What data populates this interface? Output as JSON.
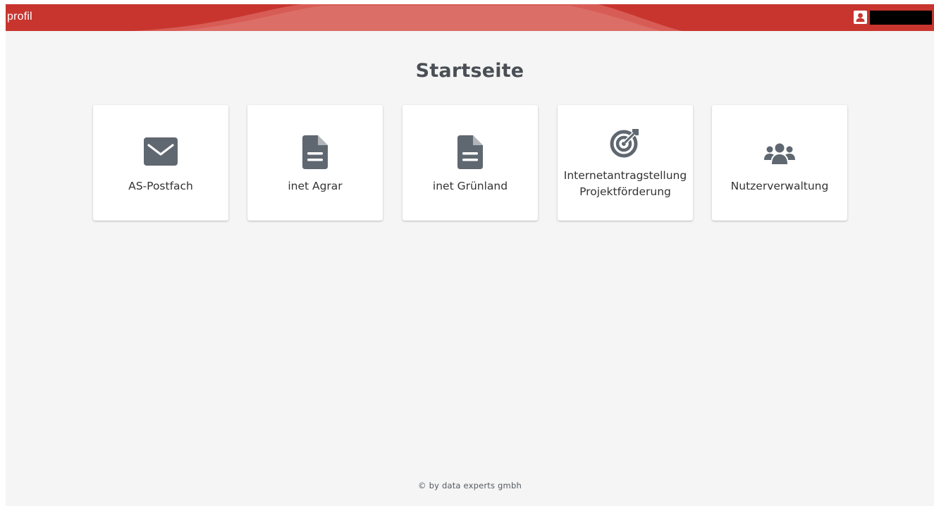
{
  "header": {
    "app_title": "profil",
    "user_icon": "user-account-icon",
    "user_name": "",
    "brand_color": "#c8352f"
  },
  "main": {
    "page_title": "Startseite",
    "tiles": [
      {
        "label": "AS-Postfach",
        "icon": "envelope-icon"
      },
      {
        "label": "inet Agrar",
        "icon": "document-icon"
      },
      {
        "label": "inet Grünland",
        "icon": "document-icon"
      },
      {
        "label_line1": "Internetantragstellung",
        "label_line2": "Projektförderung",
        "icon": "target-icon"
      },
      {
        "label": "Nutzerverwaltung",
        "icon": "users-icon"
      }
    ],
    "icon_color": "#5f6770"
  },
  "footer": {
    "copyright": "© by data experts gmbh"
  }
}
